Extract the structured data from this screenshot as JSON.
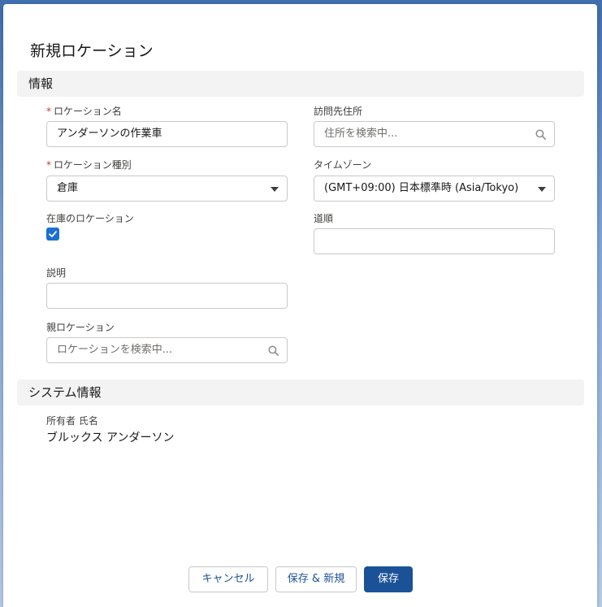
{
  "modal": {
    "title": "新規ロケーション"
  },
  "sections": {
    "info": "情報",
    "system": "システム情報"
  },
  "fields": {
    "location_name": {
      "label": "ロケーション名",
      "required": "*",
      "value": "アンダーソンの作業車"
    },
    "visit_address": {
      "label": "訪問先住所",
      "placeholder": "住所を検索中..."
    },
    "location_type": {
      "label": "ロケーション種別",
      "required": "*",
      "value": "倉庫"
    },
    "timezone": {
      "label": "タイムゾーン",
      "value": "(GMT+09:00) 日本標準時 (Asia/Tokyo)"
    },
    "inventory_location": {
      "label": "在庫のロケーション",
      "checked": true
    },
    "directions": {
      "label": "道順",
      "value": ""
    },
    "description": {
      "label": "説明",
      "value": ""
    },
    "parent_location": {
      "label": "親ロケーション",
      "placeholder": "ロケーションを検索中..."
    },
    "owner": {
      "label": "所有者 氏名",
      "value": "ブルックス アンダーソン"
    }
  },
  "buttons": {
    "cancel": "キャンセル",
    "save_new": "保存 & 新規",
    "save": "保存"
  },
  "colors": {
    "brand": "#1b5297",
    "checkbox": "#1b6fd1",
    "required": "#c23934"
  }
}
